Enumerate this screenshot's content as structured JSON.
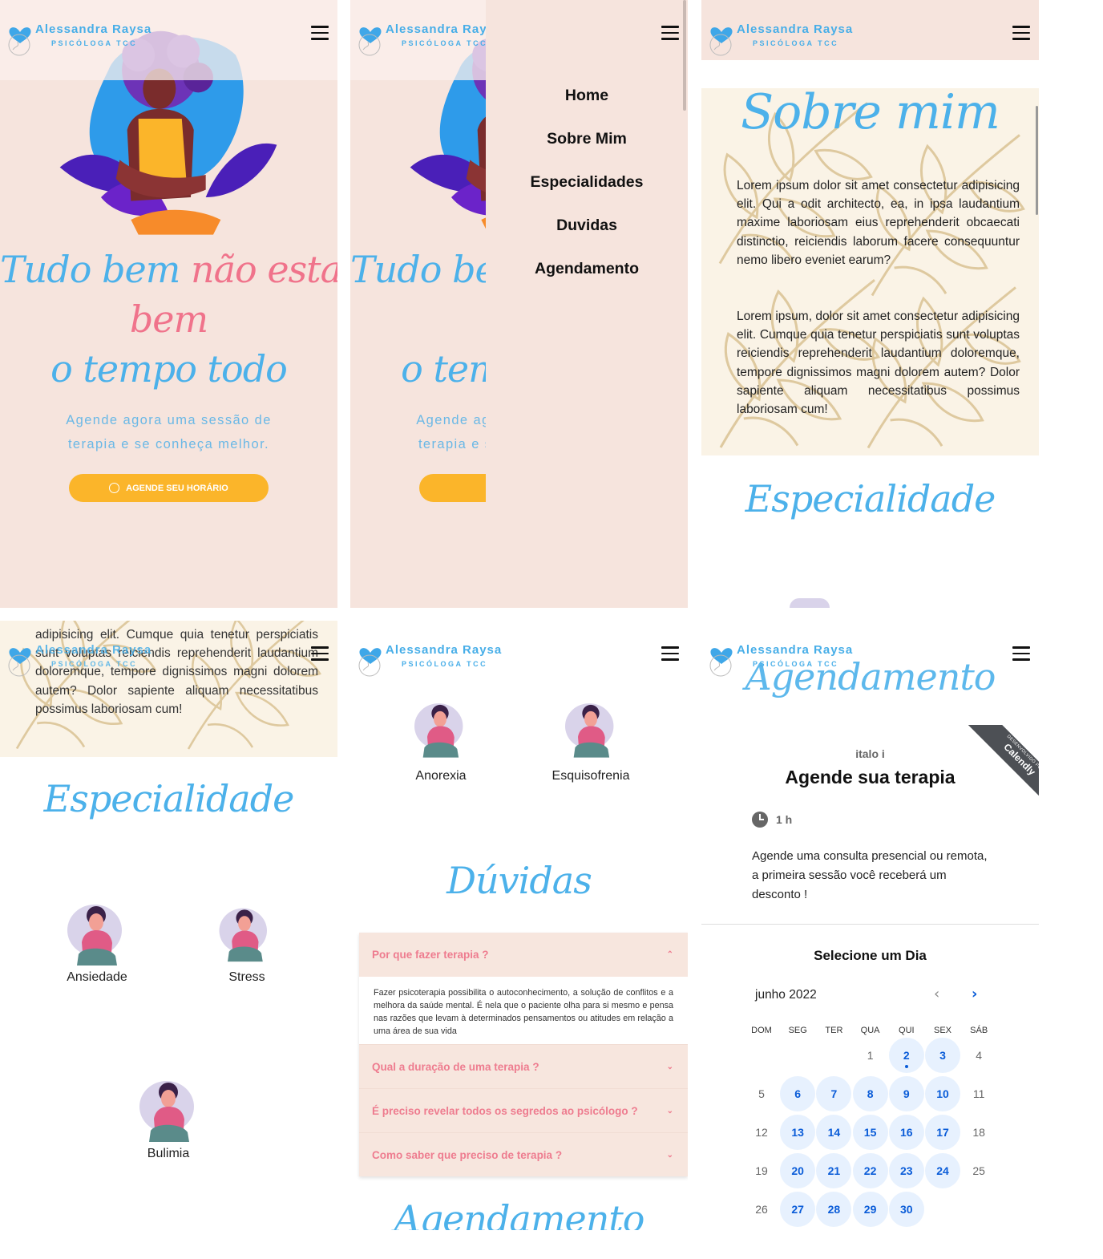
{
  "brand": {
    "name": "Alessandra Raysa",
    "subtitle": "PSICÓLOGA TCC"
  },
  "hero": {
    "title_part1": "Tudo bem",
    "title_part2": "não estar",
    "title_part3": "bem",
    "title_part4": "o tempo todo",
    "subtitle_line1": "Agende agora uma sessão de",
    "subtitle_line2": "terapia e se conheça melhor.",
    "cta_label": "AGENDE SEU HORÁRIO"
  },
  "menu": {
    "items": [
      "Home",
      "Sobre Mim",
      "Especialidades",
      "Duvidas",
      "Agendamento"
    ]
  },
  "about": {
    "title": "Sobre mim",
    "paragraph1": "Lorem ipsum dolor sit amet consectetur adipisicing elit. Qui a odit architecto, ea, in ipsa laudantium maxime laboriosam eius reprehenderit obcaecati distinctio, reiciendis laborum facere consequuntur nemo libero eveniet earum?",
    "paragraph2": "Lorem ipsum, dolor sit amet consectetur adipisicing elit. Cumque quia tenetur perspiciatis sunt voluptas reiciendis reprehenderit laudantium doloremque, tempore dignissimos magni dolorem autem? Dolor sapiente aliquam necessitatibus possimus laboriosam cum!",
    "paragraph2_tail": "adipisicing elit. Cumque quia tenetur perspiciatis sunt voluptas reiciendis reprehenderit laudantium doloremque, tempore dignissimos magni dolorem autem? Dolor sapiente aliquam necessitatibus possimus laboriosam cum!"
  },
  "specialties": {
    "title": "Especialidade",
    "items": [
      "Ansiedade",
      "Stress",
      "Bulimia",
      "Anorexia",
      "Esquisofrenia"
    ]
  },
  "faq": {
    "title": "Dúvidas",
    "items": [
      {
        "question": "Por que fazer terapia ?",
        "answer": "Fazer psicoterapia possibilita o autoconhecimento, a solução de conflitos e a melhora da saúde mental. É nela que o paciente olha para si mesmo e pensa nas razões que levam à determinados pensamentos ou atitudes em relação a uma área de sua vida"
      },
      {
        "question": "Qual a duração de uma terapia ?"
      },
      {
        "question": "É preciso revelar todos os segredos ao psicólogo ?"
      },
      {
        "question": "Como saber que preciso de terapia ?"
      }
    ]
  },
  "booking": {
    "title": "Agendamento",
    "owner": "italo i",
    "heading": "Agende sua terapia",
    "duration": "1 h",
    "description": "Agende uma consulta presencial ou remota, a primeira sessão você receberá um desconto !",
    "ribbon_small": "DESENVOLVIDO POR",
    "ribbon_brand": "Calendly",
    "select_day": "Selecione um Dia",
    "month": "junho 2022",
    "weekdays": [
      "DOM",
      "SEG",
      "TER",
      "QUA",
      "QUI",
      "SEX",
      "SÁB"
    ],
    "weeks": [
      [
        null,
        null,
        null,
        "1",
        "2",
        "3",
        "4"
      ],
      [
        "5",
        "6",
        "7",
        "8",
        "9",
        "10",
        "11"
      ],
      [
        "12",
        "13",
        "14",
        "15",
        "16",
        "17",
        "18"
      ],
      [
        "19",
        "20",
        "21",
        "22",
        "23",
        "24",
        "25"
      ],
      [
        "26",
        "27",
        "28",
        "29",
        "30",
        null,
        null
      ]
    ],
    "available": [
      "2",
      "3",
      "6",
      "7",
      "8",
      "9",
      "10",
      "13",
      "14",
      "15",
      "16",
      "17",
      "20",
      "21",
      "22",
      "23",
      "24",
      "27",
      "28",
      "29",
      "30"
    ],
    "today": "2"
  },
  "colors": {
    "blue": "#4cb1ea",
    "pink": "#f0738b",
    "peach": "#f6e4dd",
    "yellow": "#fbb52a",
    "calendar_blue": "#0a5cd8"
  }
}
